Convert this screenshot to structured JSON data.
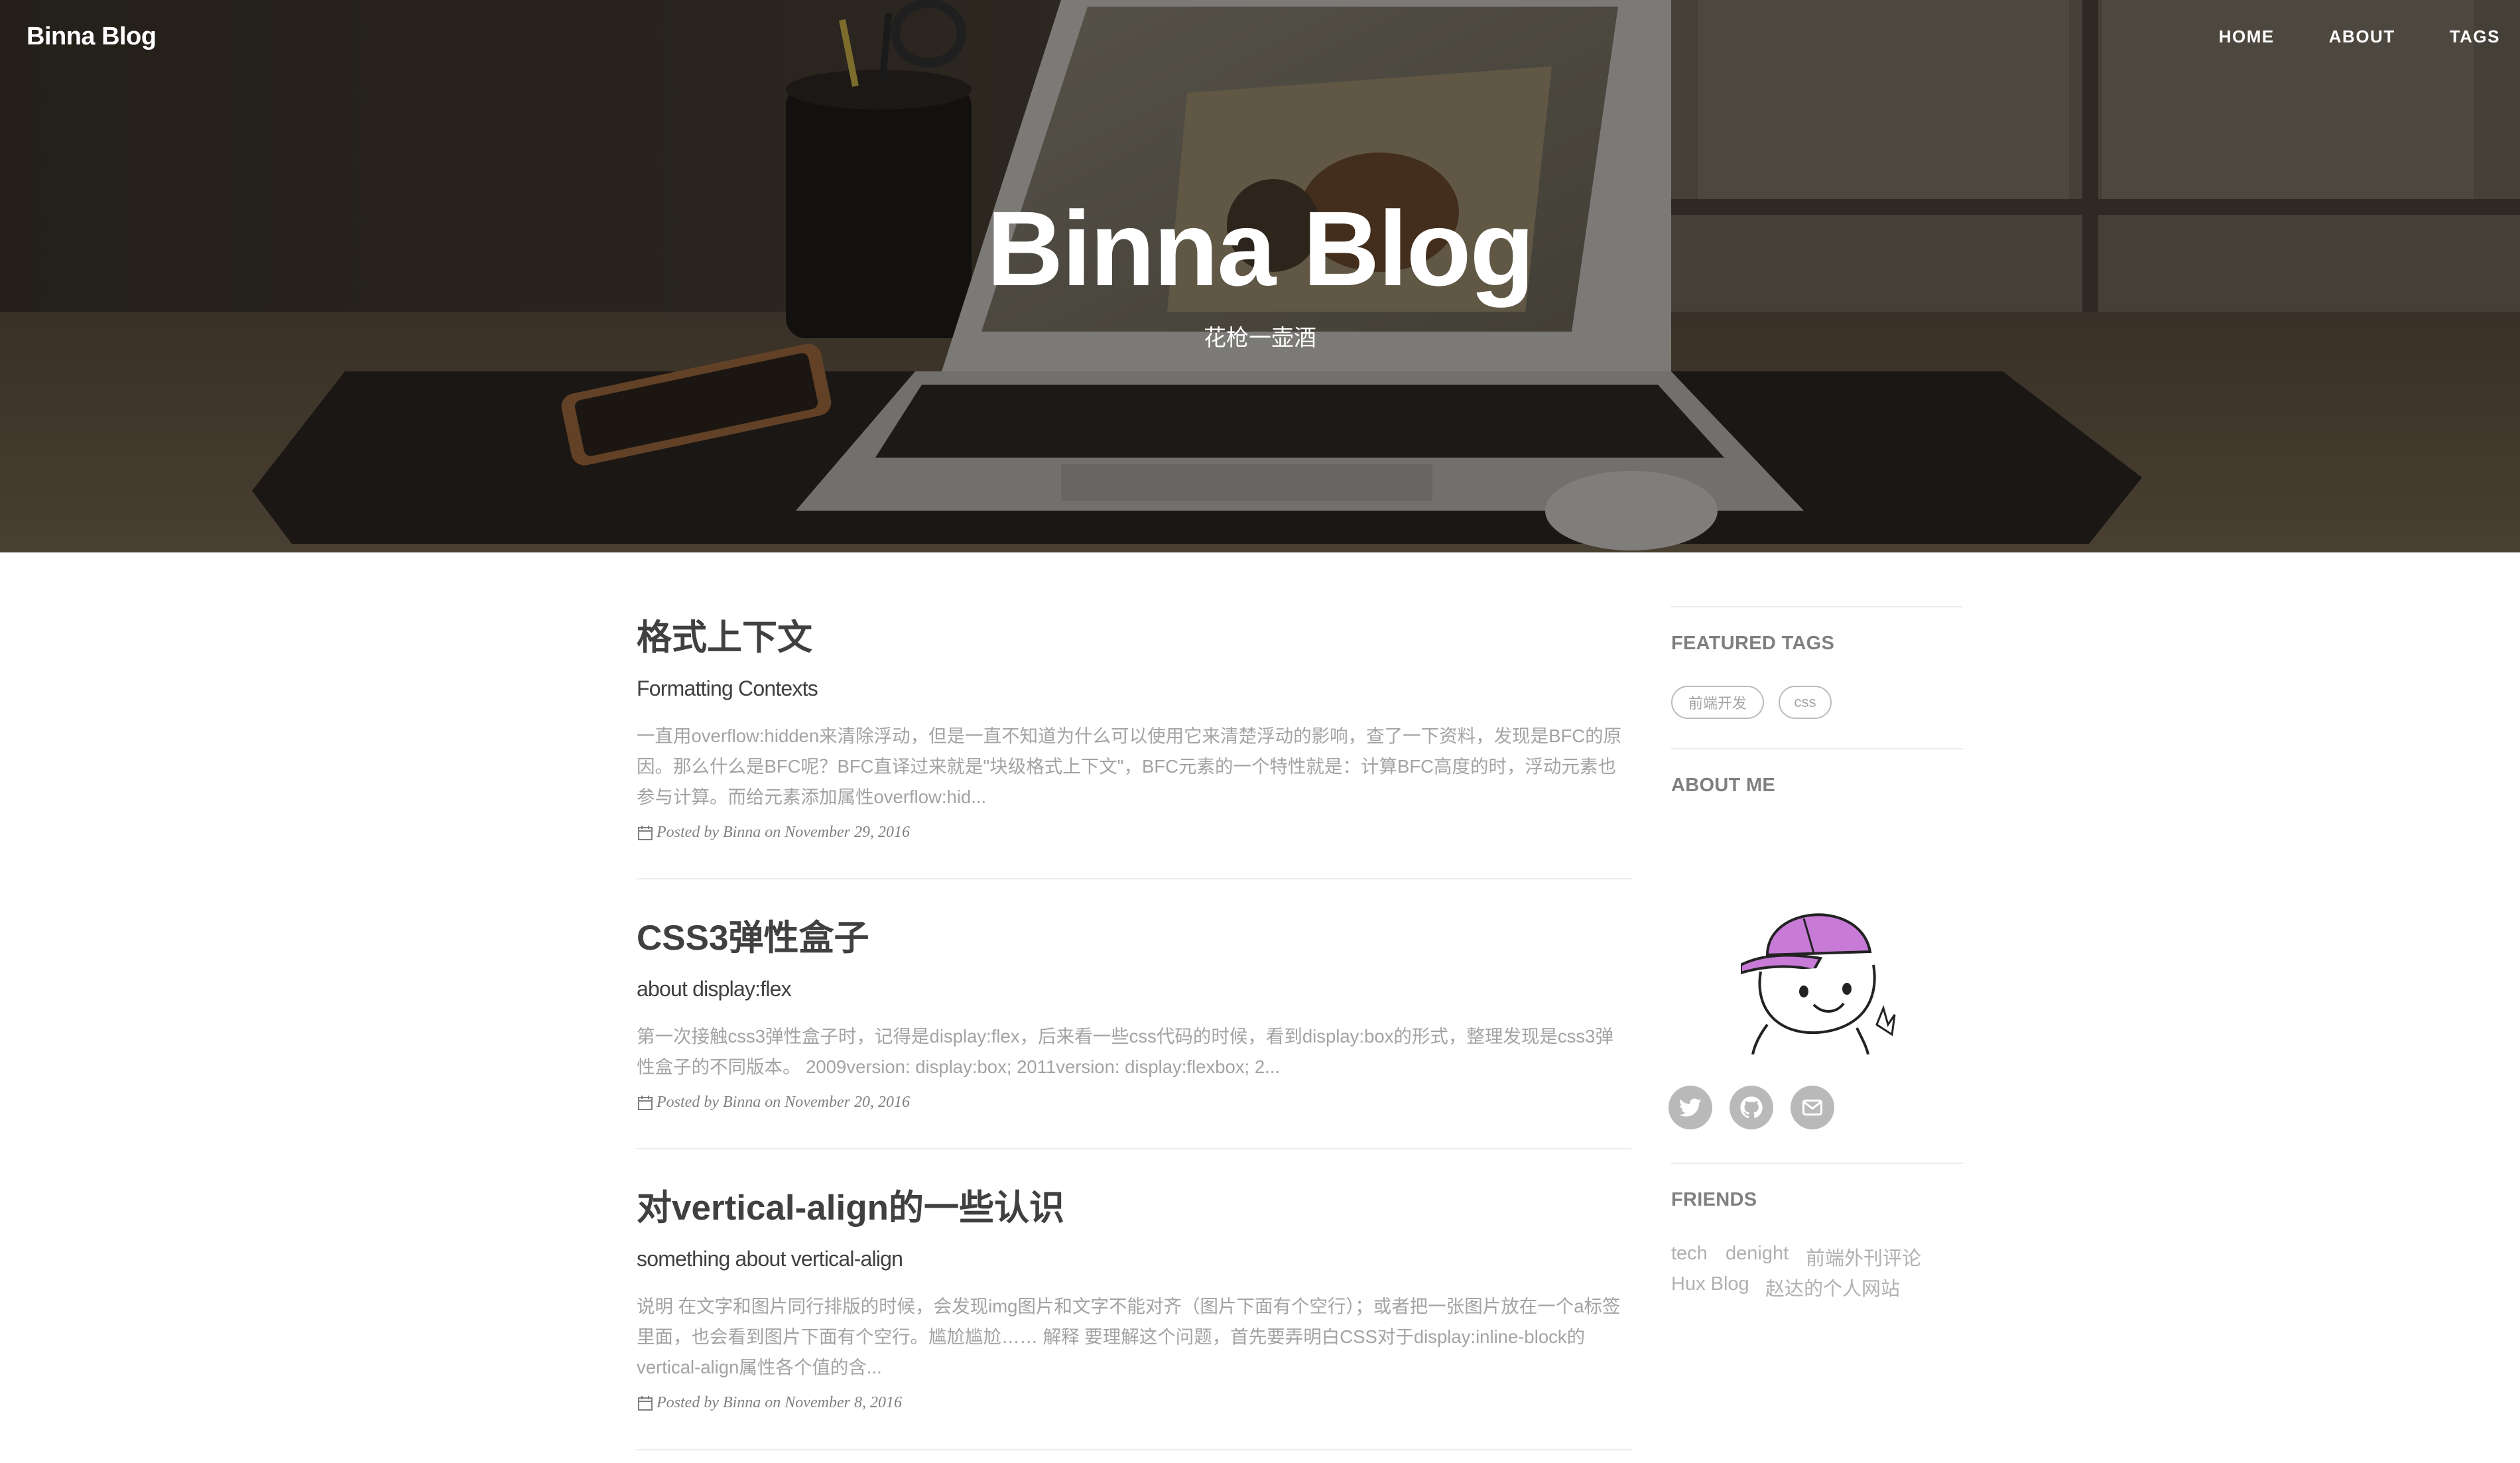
{
  "nav": {
    "brand": "Binna Blog",
    "links": [
      "HOME",
      "ABOUT",
      "TAGS"
    ]
  },
  "hero": {
    "title": "Binna Blog",
    "subtitle": "花枪一壶酒"
  },
  "posts": [
    {
      "title": "格式上下文",
      "subtitle": "Formatting Contexts",
      "excerpt": "一直用overflow:hidden来清除浮动，但是一直不知道为什么可以使用它来清楚浮动的影响，查了一下资料，发现是BFC的原因。那么什么是BFC呢？BFC直译过来就是\"块级格式上下文\"，BFC元素的一个特性就是：计算BFC高度的时，浮动元素也参与计算。而给元素添加属性overflow:hid...",
      "meta": "Posted by Binna on November 29, 2016"
    },
    {
      "title": "CSS3弹性盒子",
      "subtitle": "about display:flex",
      "excerpt": "第一次接触css3弹性盒子时，记得是display:flex，后来看一些css代码的时候，看到display:box的形式，整理发现是css3弹性盒子的不同版本。 2009version: display:box; 2011version: display:flexbox; 2...",
      "meta": "Posted by Binna on November 20, 2016"
    },
    {
      "title": "对vertical-align的一些认识",
      "subtitle": "something about vertical-align",
      "excerpt": "说明 在文字和图片同行排版的时候，会发现img图片和文字不能对齐（图片下面有个空行）；或者把一张图片放在一个a标签里面，也会看到图片下面有个空行。尴尬尴尬…… 解释 要理解这个问题，首先要弄明白CSS对于display:inline-block的vertical-align属性各个值的含...",
      "meta": "Posted by Binna on November 8, 2016"
    }
  ],
  "sidebar": {
    "featured_tags_heading": "FEATURED TAGS",
    "tags": [
      "前端开发",
      "css"
    ],
    "about_heading": "ABOUT ME",
    "social_icons": [
      "twitter-icon",
      "github-icon",
      "email-icon"
    ],
    "friends_heading": "FRIENDS",
    "friends": [
      "tech",
      "denight",
      "前端外刊评论",
      "Hux Blog",
      "赵达的个人网站"
    ]
  }
}
